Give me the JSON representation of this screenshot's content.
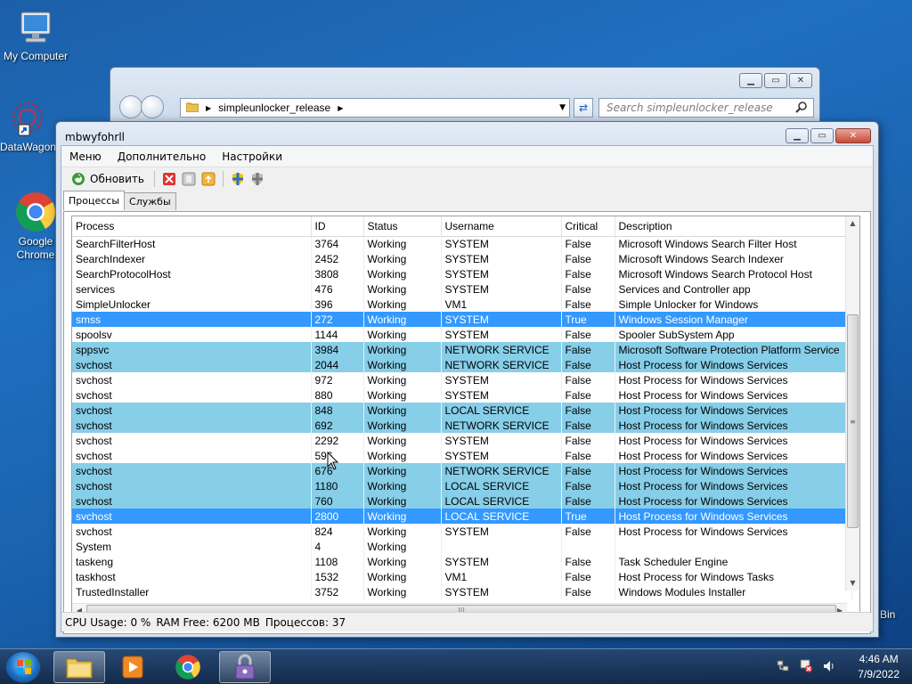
{
  "desktop": {
    "icons": [
      {
        "label": "My Computer"
      },
      {
        "label": "DataWagon"
      },
      {
        "label": "Google Chrome"
      }
    ],
    "recycle_bin_label": "Bin"
  },
  "explorer": {
    "address": "simpleunlocker_release",
    "search_placeholder": "Search simpleunlocker_release"
  },
  "window": {
    "title": "mbwyfohrll",
    "menu": [
      "Меню",
      "Дополнительно",
      "Настройки"
    ],
    "toolbar": {
      "refresh_label": "Обновить"
    },
    "tabs": [
      "Процессы",
      "Службы"
    ],
    "columns": [
      "Process",
      "ID",
      "Status",
      "Username",
      "Critical",
      "Description"
    ],
    "rows": [
      [
        "SearchFilterHost",
        "3764",
        "Working",
        "SYSTEM",
        "False",
        "Microsoft Windows Search Filter Host"
      ],
      [
        "SearchIndexer",
        "2452",
        "Working",
        "SYSTEM",
        "False",
        "Microsoft Windows Search Indexer"
      ],
      [
        "SearchProtocolHost",
        "3808",
        "Working",
        "SYSTEM",
        "False",
        "Microsoft Windows Search Protocol Host"
      ],
      [
        "services",
        "476",
        "Working",
        "SYSTEM",
        "False",
        "Services and Controller app"
      ],
      [
        "SimpleUnlocker",
        "396",
        "Working",
        "VM1",
        "False",
        "Simple Unlocker for Windows"
      ],
      [
        "smss",
        "272",
        "Working",
        "SYSTEM",
        "True",
        "Windows Session Manager"
      ],
      [
        "spoolsv",
        "1144",
        "Working",
        "SYSTEM",
        "False",
        "Spooler SubSystem App"
      ],
      [
        "sppsvc",
        "3984",
        "Working",
        "NETWORK SERVICE",
        "False",
        "Microsoft Software Protection Platform Service"
      ],
      [
        "svchost",
        "2044",
        "Working",
        "NETWORK SERVICE",
        "False",
        "Host Process for Windows Services"
      ],
      [
        "svchost",
        "972",
        "Working",
        "SYSTEM",
        "False",
        "Host Process for Windows Services"
      ],
      [
        "svchost",
        "880",
        "Working",
        "SYSTEM",
        "False",
        "Host Process for Windows Services"
      ],
      [
        "svchost",
        "848",
        "Working",
        "LOCAL SERVICE",
        "False",
        "Host Process for Windows Services"
      ],
      [
        "svchost",
        "692",
        "Working",
        "NETWORK SERVICE",
        "False",
        "Host Process for Windows Services"
      ],
      [
        "svchost",
        "2292",
        "Working",
        "SYSTEM",
        "False",
        "Host Process for Windows Services"
      ],
      [
        "svchost",
        "596",
        "Working",
        "SYSTEM",
        "False",
        "Host Process for Windows Services"
      ],
      [
        "svchost",
        "676",
        "Working",
        "NETWORK SERVICE",
        "False",
        "Host Process for Windows Services"
      ],
      [
        "svchost",
        "1180",
        "Working",
        "LOCAL SERVICE",
        "False",
        "Host Process for Windows Services"
      ],
      [
        "svchost",
        "760",
        "Working",
        "LOCAL SERVICE",
        "False",
        "Host Process for Windows Services"
      ],
      [
        "svchost",
        "2800",
        "Working",
        "LOCAL SERVICE",
        "True",
        "Host Process for Windows Services"
      ],
      [
        "svchost",
        "824",
        "Working",
        "SYSTEM",
        "False",
        "Host Process for Windows Services"
      ],
      [
        "System",
        "4",
        "Working",
        "",
        "",
        ""
      ],
      [
        "taskeng",
        "1108",
        "Working",
        "SYSTEM",
        "False",
        "Task Scheduler Engine"
      ],
      [
        "taskhost",
        "1532",
        "Working",
        "VM1",
        "False",
        "Host Process for Windows Tasks"
      ],
      [
        "TrustedInstaller",
        "3752",
        "Working",
        "SYSTEM",
        "False",
        "Windows Modules Installer"
      ]
    ],
    "row_styles": [
      "",
      "",
      "",
      "",
      "",
      "sel",
      "",
      "blue",
      "blue",
      "",
      "",
      "blue",
      "blue",
      "",
      "",
      "blue",
      "blue",
      "blue",
      "sel",
      "",
      "",
      "",
      "",
      ""
    ],
    "status": {
      "cpu": "CPU Usage: 0 %",
      "ram": "RAM Free: 6200 MB",
      "processes": "Процессов: 37"
    }
  },
  "taskbar": {
    "time": "4:46 AM",
    "date": "7/9/2022"
  },
  "colors": {
    "row_highlight": "#87cee8",
    "row_selected": "#3399ff",
    "desktop": "#1f6fc0"
  }
}
